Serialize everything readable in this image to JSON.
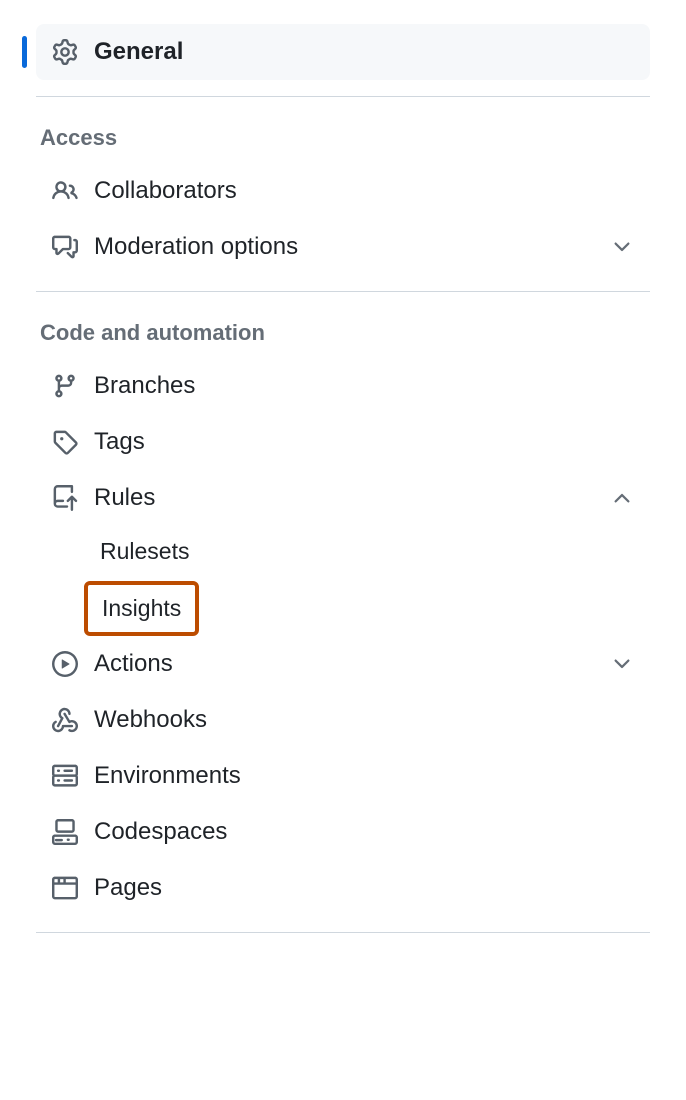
{
  "sidebar": {
    "general": {
      "label": "General"
    },
    "sections": [
      {
        "title": "Access",
        "items": [
          {
            "label": "Collaborators",
            "icon": "people-icon"
          },
          {
            "label": "Moderation options",
            "icon": "comment-discussion-icon",
            "expandable": true,
            "expanded": false
          }
        ]
      },
      {
        "title": "Code and automation",
        "items": [
          {
            "label": "Branches",
            "icon": "git-branch-icon"
          },
          {
            "label": "Tags",
            "icon": "tag-icon"
          },
          {
            "label": "Rules",
            "icon": "repo-push-icon",
            "expandable": true,
            "expanded": true,
            "sub_items": [
              {
                "label": "Rulesets"
              },
              {
                "label": "Insights",
                "highlighted": true
              }
            ]
          },
          {
            "label": "Actions",
            "icon": "play-icon",
            "expandable": true,
            "expanded": false
          },
          {
            "label": "Webhooks",
            "icon": "webhook-icon"
          },
          {
            "label": "Environments",
            "icon": "server-icon"
          },
          {
            "label": "Codespaces",
            "icon": "codespaces-icon"
          },
          {
            "label": "Pages",
            "icon": "browser-icon"
          }
        ]
      }
    ]
  }
}
